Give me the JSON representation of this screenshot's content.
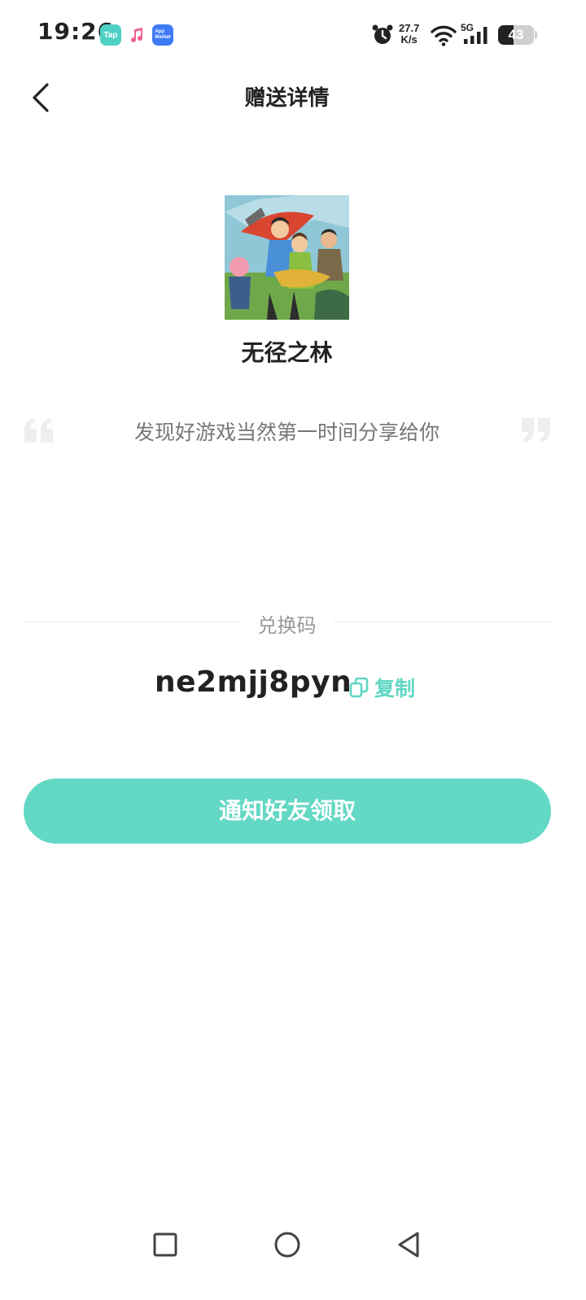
{
  "status_bar": {
    "time": "19:26",
    "net_speed_value": "27.7",
    "net_speed_unit": "K/s",
    "network_type": "5G",
    "battery_level": "43",
    "battery_fraction": 0.43,
    "app_icons": [
      {
        "name": "taptap-app-icon",
        "text": "Tap",
        "color": "#4fd1c5"
      },
      {
        "name": "music-app-icon",
        "text": "♪",
        "color": "#f06292"
      },
      {
        "name": "app-market-icon",
        "text": "App Market",
        "color": "#3d7af5"
      }
    ]
  },
  "header": {
    "back_icon": "chevron-left-icon",
    "title": "赠送详情"
  },
  "game": {
    "name": "无径之林",
    "cover_icon": "game-cover-art"
  },
  "share": {
    "message": "发现好游戏当然第一时间分享给你"
  },
  "redeem": {
    "label": "兑换码",
    "code": "ne2mjj8pyn",
    "copy_label": "复制"
  },
  "action": {
    "notify_label": "通知好友领取"
  },
  "colors": {
    "accent": "#63d8c5",
    "copy_text": "#5fd6c3",
    "text_primary": "#222222",
    "text_secondary": "#777777"
  },
  "nav_bar": {
    "recent_icon": "square-icon",
    "home_icon": "circle-icon",
    "back_icon": "triangle-back-icon"
  }
}
